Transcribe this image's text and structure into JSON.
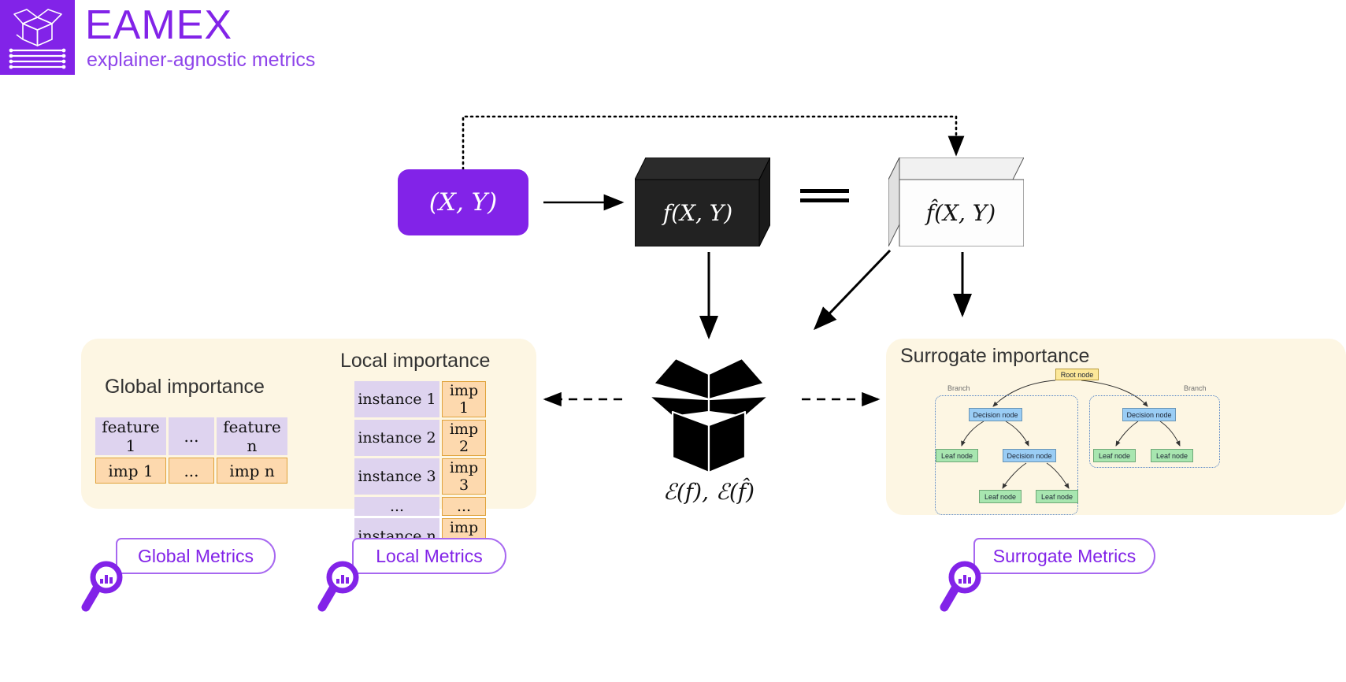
{
  "brand": {
    "title": "EAMEX",
    "subtitle": "explainer-agnostic metrics",
    "logo_icon": "open-box-icon",
    "accent_color": "#8223e8"
  },
  "pipeline": {
    "data_node": "(X, Y)",
    "blackbox_node": "f(X, Y)",
    "surrogate_node": "f̂(X, Y)",
    "equals_symbol": "≈",
    "explainer_icon": "open-box-icon",
    "explainer_label": "ℰ(f),  ℰ(f̂)"
  },
  "panels": {
    "global": {
      "title": "Global importance",
      "headers": [
        "feature 1",
        "...",
        "feature n"
      ],
      "values": [
        "imp 1",
        "...",
        "imp n"
      ],
      "header_color": "#ded3ef",
      "value_color": "#fdd9ae",
      "value_border": "#e0a33b"
    },
    "local": {
      "title": "Local importance",
      "rows": [
        {
          "name": "instance 1",
          "value": "imp 1"
        },
        {
          "name": "instance 2",
          "value": "imp 2"
        },
        {
          "name": "instance 3",
          "value": "imp 3"
        },
        {
          "name": "...",
          "value": "..."
        },
        {
          "name": "instance n",
          "value": "imp n"
        }
      ]
    },
    "surrogate": {
      "title": "Surrogate importance",
      "tree": {
        "root_label": "Root node",
        "decision_label": "Decision node",
        "leaf_label": "Leaf node",
        "branch_label": "Branch",
        "root_color": "#fce89a",
        "decision_color": "#9acdf5",
        "leaf_color": "#a8e6b0",
        "branch_border_color": "#4d7fc4"
      }
    }
  },
  "metrics": [
    {
      "label": "Global Metrics",
      "icon": "magnifier-chart-icon"
    },
    {
      "label": "Local Metrics",
      "icon": "magnifier-chart-icon"
    },
    {
      "label": "Surrogate Metrics",
      "icon": "magnifier-chart-icon"
    }
  ]
}
